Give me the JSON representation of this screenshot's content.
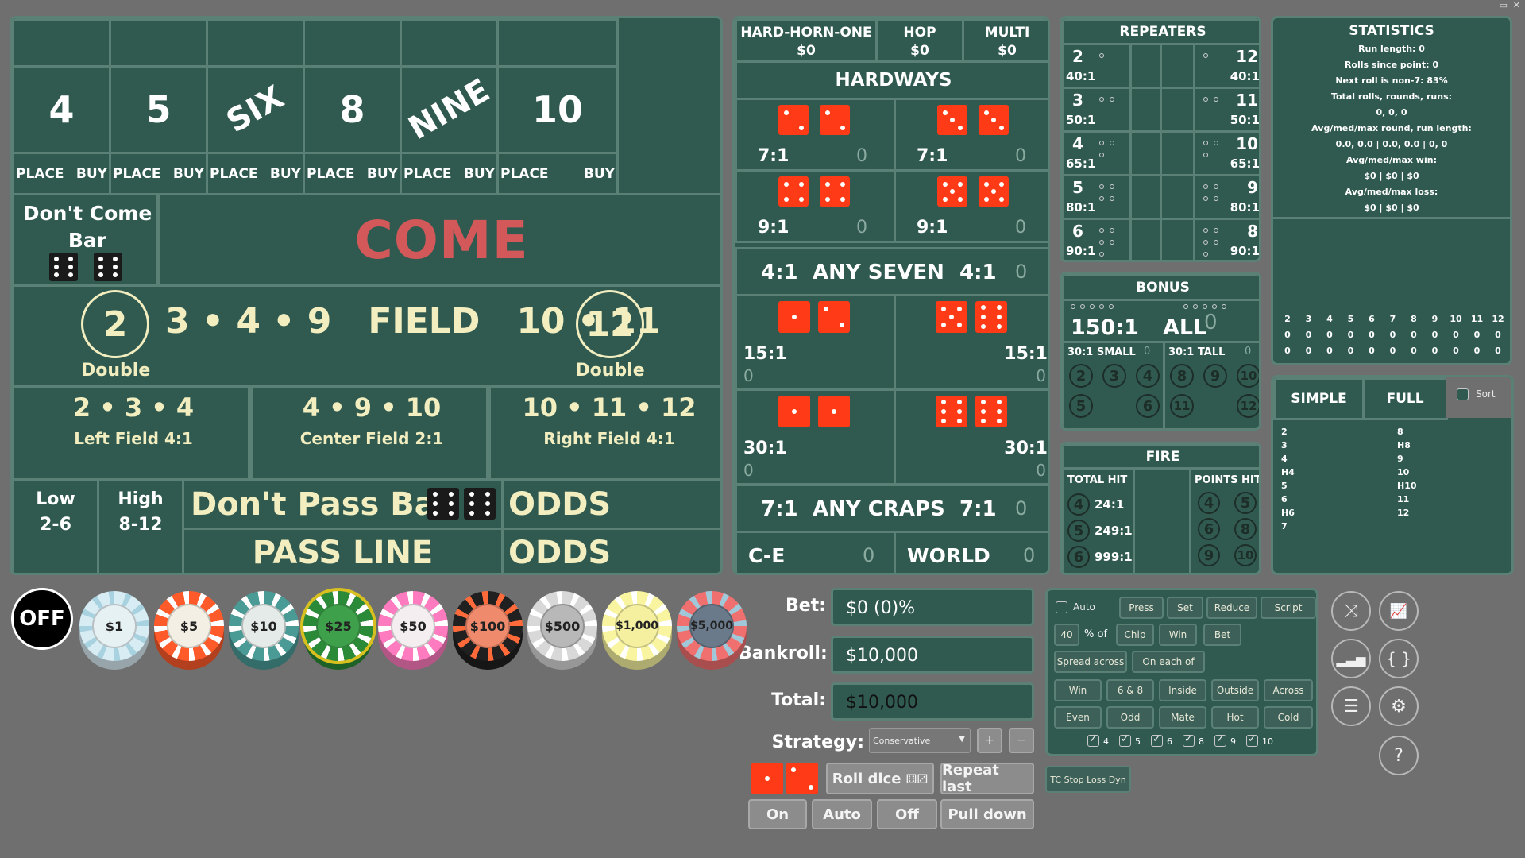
{
  "window_controls": {
    "restore": "▭",
    "close": "✕"
  },
  "points": {
    "labels": [
      "4",
      "5",
      "SIX",
      "8",
      "NINE",
      "10"
    ],
    "place_label": "PLACE",
    "buy_label": "BUY"
  },
  "dont_come": {
    "line1": "Don't Come",
    "line2": "Bar"
  },
  "come": "COME",
  "field": {
    "two": "2",
    "twelve": "12",
    "text": "3 • 4 • 9   FIELD   10 • 11",
    "double_left": "Double",
    "double_right": "Double"
  },
  "subfields": [
    {
      "nums": "2 • 3 • 4",
      "label": "Left Field 4:1"
    },
    {
      "nums": "4 • 9 • 10",
      "label": "Center Field 2:1"
    },
    {
      "nums": "10 • 11 • 12",
      "label": "Right Field 4:1"
    }
  ],
  "low": {
    "l1": "Low",
    "l2": "2-6"
  },
  "high": {
    "l1": "High",
    "l2": "8-12"
  },
  "dont_pass_bar": "Don't Pass Bar",
  "pass_line": "PASS LINE",
  "odds": "ODDS",
  "props": {
    "hho": {
      "label": "HARD-HORN-ONE",
      "value": "$0"
    },
    "hop": {
      "label": "HOP",
      "value": "$0"
    },
    "multi": {
      "label": "MULTI",
      "value": "$0"
    },
    "hardways": "HARDWAYS",
    "hard": [
      {
        "odds": "7:1",
        "count": "0"
      },
      {
        "odds": "7:1",
        "count": "0"
      },
      {
        "odds": "9:1",
        "count": "0"
      },
      {
        "odds": "9:1",
        "count": "0"
      }
    ],
    "any_seven": {
      "left": "4:1",
      "label": "ANY SEVEN",
      "right": "4:1",
      "count": "0"
    },
    "horn": [
      {
        "odds": "15:1",
        "count": "0"
      },
      {
        "odds": "15:1",
        "count": "0"
      },
      {
        "odds": "30:1",
        "count": "0"
      },
      {
        "odds": "30:1",
        "count": "0"
      }
    ],
    "any_craps": {
      "left": "7:1",
      "label": "ANY CRAPS",
      "right": "7:1",
      "count": "0"
    },
    "ce": {
      "label": "C-E",
      "count": "0"
    },
    "world": {
      "label": "WORLD",
      "count": "0"
    }
  },
  "repeaters": {
    "title": "REPEATERS",
    "left": [
      {
        "num": "2",
        "odds": "40:1"
      },
      {
        "num": "3",
        "odds": "50:1"
      },
      {
        "num": "4",
        "odds": "65:1"
      },
      {
        "num": "5",
        "odds": "80:1"
      },
      {
        "num": "6",
        "odds": "90:1"
      }
    ],
    "right": [
      {
        "num": "12",
        "odds": "40:1"
      },
      {
        "num": "11",
        "odds": "50:1"
      },
      {
        "num": "10",
        "odds": "65:1"
      },
      {
        "num": "9",
        "odds": "80:1"
      },
      {
        "num": "8",
        "odds": "90:1"
      }
    ]
  },
  "bonus": {
    "title": "BONUS",
    "all_odds": "150:1",
    "all_label": "ALL",
    "all_count": "0",
    "small": {
      "label": "30:1 SMALL",
      "count": "0"
    },
    "tall": {
      "label": "30:1 TALL",
      "count": "0"
    },
    "small_nums": [
      "2",
      "3",
      "4",
      "5",
      "6"
    ],
    "tall_nums": [
      "8",
      "9",
      "10",
      "11",
      "12"
    ]
  },
  "fire": {
    "title": "FIRE",
    "total_hit": "TOTAL HIT",
    "points_hit": "POINTS HIT",
    "rows": [
      {
        "n": "4",
        "odds": "24:1"
      },
      {
        "n": "5",
        "odds": "249:1"
      },
      {
        "n": "6",
        "odds": "999:1"
      }
    ],
    "points": [
      "4",
      "5",
      "6",
      "8",
      "9",
      "10"
    ]
  },
  "statistics": {
    "title": "STATISTICS",
    "lines": [
      "Run length: 0",
      "Rolls since point: 0",
      "Next roll is non-7: 83%",
      "Total rolls, rounds, runs:",
      "0, 0, 0",
      "Avg/med/max round, run length:",
      "0.0, 0.0 | 0.0, 0.0 | 0, 0",
      "Avg/med/max win:",
      "$0 | $0 | $0",
      "Avg/med/max loss:",
      "$0 | $0 | $0"
    ],
    "hist_nums": [
      "2",
      "3",
      "4",
      "5",
      "6",
      "7",
      "8",
      "9",
      "10",
      "11",
      "12"
    ],
    "hist_counts": [
      "0",
      "0",
      "0",
      "0",
      "0",
      "0",
      "0",
      "0",
      "0",
      "0",
      "0"
    ],
    "hist_counts2": [
      "0",
      "0",
      "0",
      "0",
      "0",
      "0",
      "0",
      "0",
      "0",
      "0",
      "0"
    ]
  },
  "view": {
    "simple": "SIMPLE",
    "full": "FULL",
    "sort": "Sort",
    "left_list": [
      "2",
      "3",
      "4",
      "H4",
      "5",
      "6",
      "H6",
      "7"
    ],
    "right_list": [
      "8",
      "H8",
      "9",
      "10",
      "H10",
      "11",
      "12"
    ]
  },
  "chips": {
    "off": "OFF",
    "items": [
      {
        "label": "$1",
        "rim": "#d8ecf4",
        "face": "#e6f1f4",
        "stripe": "#a9d2e0"
      },
      {
        "label": "$5",
        "rim": "#ff5a2a",
        "face": "#f3efe4",
        "stripe": "#ffffff"
      },
      {
        "label": "$10",
        "rim": "#4a9a96",
        "face": "#e4ebe8",
        "stripe": "#ffffff"
      },
      {
        "label": "$25",
        "rim": "#2a8a38",
        "face": "#3ea04a",
        "stripe": "#ffffff"
      },
      {
        "label": "$50",
        "rim": "#ff7bbf",
        "face": "#f5eef0",
        "stripe": "#ffffff"
      },
      {
        "label": "$100",
        "rim": "#202020",
        "face": "#f08a6c",
        "stripe": "#ff6a3a"
      },
      {
        "label": "$500",
        "rim": "#d8d8d8",
        "face": "#b8b8b8",
        "stripe": "#ffffff"
      },
      {
        "label": "$1,000",
        "rim": "#f8f4a0",
        "face": "#f4f0a0",
        "stripe": "#ffffff"
      },
      {
        "label": "$5,000",
        "rim": "#f07070",
        "face": "#6a7a8a",
        "stripe": "#a0c8d8"
      }
    ]
  },
  "money": {
    "bet_label": "Bet:",
    "bet_value": "$0 (0)%",
    "bankroll_label": "Bankroll:",
    "bankroll_value": "$10,000",
    "total_label": "Total:",
    "total_value": "$10,000",
    "strategy_label": "Strategy:",
    "strategy_value": "Conservative",
    "plus": "+",
    "minus": "−"
  },
  "roll": {
    "roll_dice": "Roll dice",
    "repeat_last": "Repeat last",
    "on": "On",
    "auto": "Auto",
    "off": "Off",
    "pull_down": "Pull down"
  },
  "auto_panel": {
    "auto": "Auto",
    "press": "Press",
    "set": "Set",
    "reduce": "Reduce",
    "script": "Script",
    "pct_value": "40",
    "pct_of": "% of",
    "chip": "Chip",
    "win": "Win",
    "bet": "Bet",
    "spread_across": "Spread across",
    "on_each_of": "On each of",
    "row1": [
      "Win",
      "6 & 8",
      "Inside",
      "Outside",
      "Across"
    ],
    "row2": [
      "Even",
      "Odd",
      "Mate",
      "Hot",
      "Cold"
    ],
    "checks": [
      "4",
      "5",
      "6",
      "8",
      "9",
      "10"
    ],
    "tc_stop": "TC Stop Loss Dyn"
  },
  "right_buttons": {
    "shuffle": "⤨",
    "chart": "📈",
    "bars": "▂▃▅",
    "braces": "{ }",
    "list": "☰",
    "gear": "⚙",
    "help": "?"
  }
}
